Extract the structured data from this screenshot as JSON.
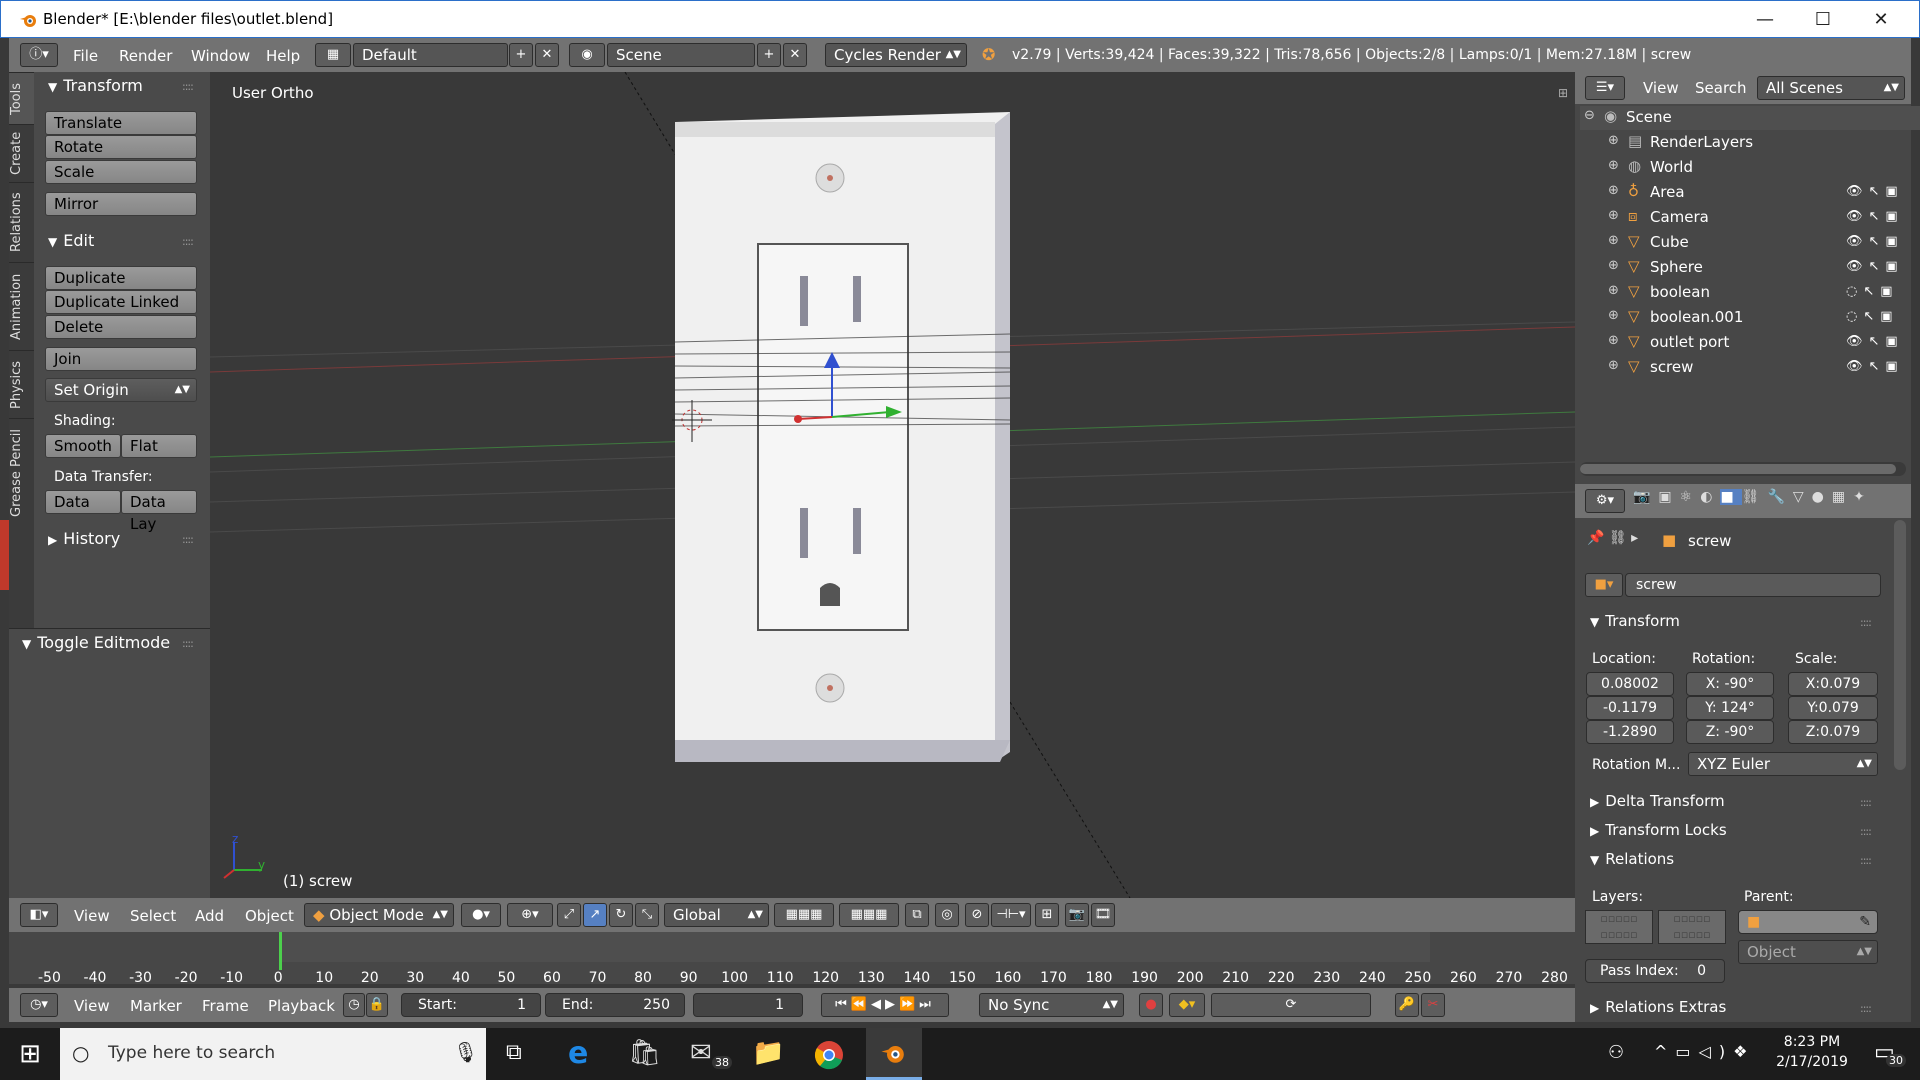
{
  "window": {
    "title": "Blender* [E:\\blender files\\outlet.blend]",
    "min_glyph": "—",
    "max_glyph": "☐",
    "close_glyph": "✕"
  },
  "topbar": {
    "menus": [
      "File",
      "Render",
      "Window",
      "Help"
    ],
    "layout": "Default",
    "scene": "Scene",
    "engine": "Cycles Render",
    "stats": "v2.79 | Verts:39,424 | Faces:39,322 | Tris:78,656 | Objects:2/8 | Lamps:0/1 | Mem:27.18M | screw"
  },
  "tool_tabs": [
    "Tools",
    "Create",
    "Relations",
    "Animation",
    "Physics",
    "Grease Pencil"
  ],
  "tools": {
    "transform_header": "Transform",
    "translate": "Translate",
    "rotate": "Rotate",
    "scale": "Scale",
    "mirror": "Mirror",
    "edit_header": "Edit",
    "duplicate": "Duplicate",
    "duplicate_linked": "Duplicate Linked",
    "delete": "Delete",
    "join": "Join",
    "set_origin": "Set Origin",
    "shading_label": "Shading:",
    "smooth": "Smooth",
    "flat": "Flat",
    "data_transfer_label": "Data Transfer:",
    "data": "Data",
    "data_lay": "Data Lay",
    "history_header": "History",
    "toggle_editmode": "Toggle Editmode"
  },
  "viewport": {
    "view_name": "User Ortho",
    "object_label": "(1) screw",
    "axis_z": "z",
    "axis_y": "y"
  },
  "view3d_header": {
    "view": "View",
    "select": "Select",
    "add": "Add",
    "object": "Object",
    "mode": "Object Mode",
    "orientation": "Global"
  },
  "timeline": {
    "ticks": [
      "-50",
      "-40",
      "-30",
      "-20",
      "-10",
      "0",
      "10",
      "20",
      "30",
      "40",
      "50",
      "60",
      "70",
      "80",
      "90",
      "100",
      "110",
      "120",
      "130",
      "140",
      "150",
      "160",
      "170",
      "180",
      "190",
      "200",
      "210",
      "220",
      "230",
      "240",
      "250",
      "260",
      "270",
      "280"
    ],
    "current_frame_pos": 0,
    "view": "View",
    "marker": "Marker",
    "frame": "Frame",
    "playback": "Playback",
    "start_label": "Start:",
    "start_value": "1",
    "end_label": "End:",
    "end_value": "250",
    "current": "1",
    "sync": "No Sync"
  },
  "outliner": {
    "view": "View",
    "search": "Search",
    "filter": "All Scenes",
    "rows": [
      {
        "name": "Scene",
        "icon": "scene-icon",
        "indent": 0
      },
      {
        "name": "RenderLayers",
        "icon": "renderlayers-icon",
        "indent": 1
      },
      {
        "name": "World",
        "icon": "world-icon",
        "indent": 1
      },
      {
        "name": "Area",
        "icon": "lamp-icon",
        "indent": 1
      },
      {
        "name": "Camera",
        "icon": "camera-icon",
        "indent": 1
      },
      {
        "name": "Cube",
        "icon": "mesh-icon",
        "indent": 1
      },
      {
        "name": "Sphere",
        "icon": "mesh-icon",
        "indent": 1
      },
      {
        "name": "boolean",
        "icon": "mesh-icon",
        "indent": 1
      },
      {
        "name": "boolean.001",
        "icon": "mesh-icon",
        "indent": 1
      },
      {
        "name": "outlet port",
        "icon": "mesh-icon",
        "indent": 1
      },
      {
        "name": "screw",
        "icon": "mesh-icon",
        "indent": 1
      }
    ]
  },
  "properties": {
    "breadcrumb": "screw",
    "object_name": "screw",
    "transform_header": "Transform",
    "location_label": "Location:",
    "rotation_label": "Rotation:",
    "scale_label": "Scale:",
    "loc": [
      "0.08002",
      "-0.1179",
      "-1.2890"
    ],
    "rot": [
      "X:  -90°",
      "Y:  124°",
      "Z:  -90°"
    ],
    "scale": [
      "X:0.079",
      "Y:0.079",
      "Z:0.079"
    ],
    "rotation_mode_label": "Rotation M...",
    "rotation_mode": "XYZ Euler",
    "delta_transform": "Delta Transform",
    "transform_locks": "Transform Locks",
    "relations": "Relations",
    "layers_label": "Layers:",
    "parent_label": "Parent:",
    "parent_type": "Object",
    "pass_index_label": "Pass Index:",
    "pass_index": "0",
    "relations_extras": "Relations Extras"
  },
  "taskbar": {
    "search_placeholder": "Type here to search",
    "mail_badge": "38",
    "time": "8:23 PM",
    "date": "2/17/2019",
    "notif_badge": "30"
  }
}
